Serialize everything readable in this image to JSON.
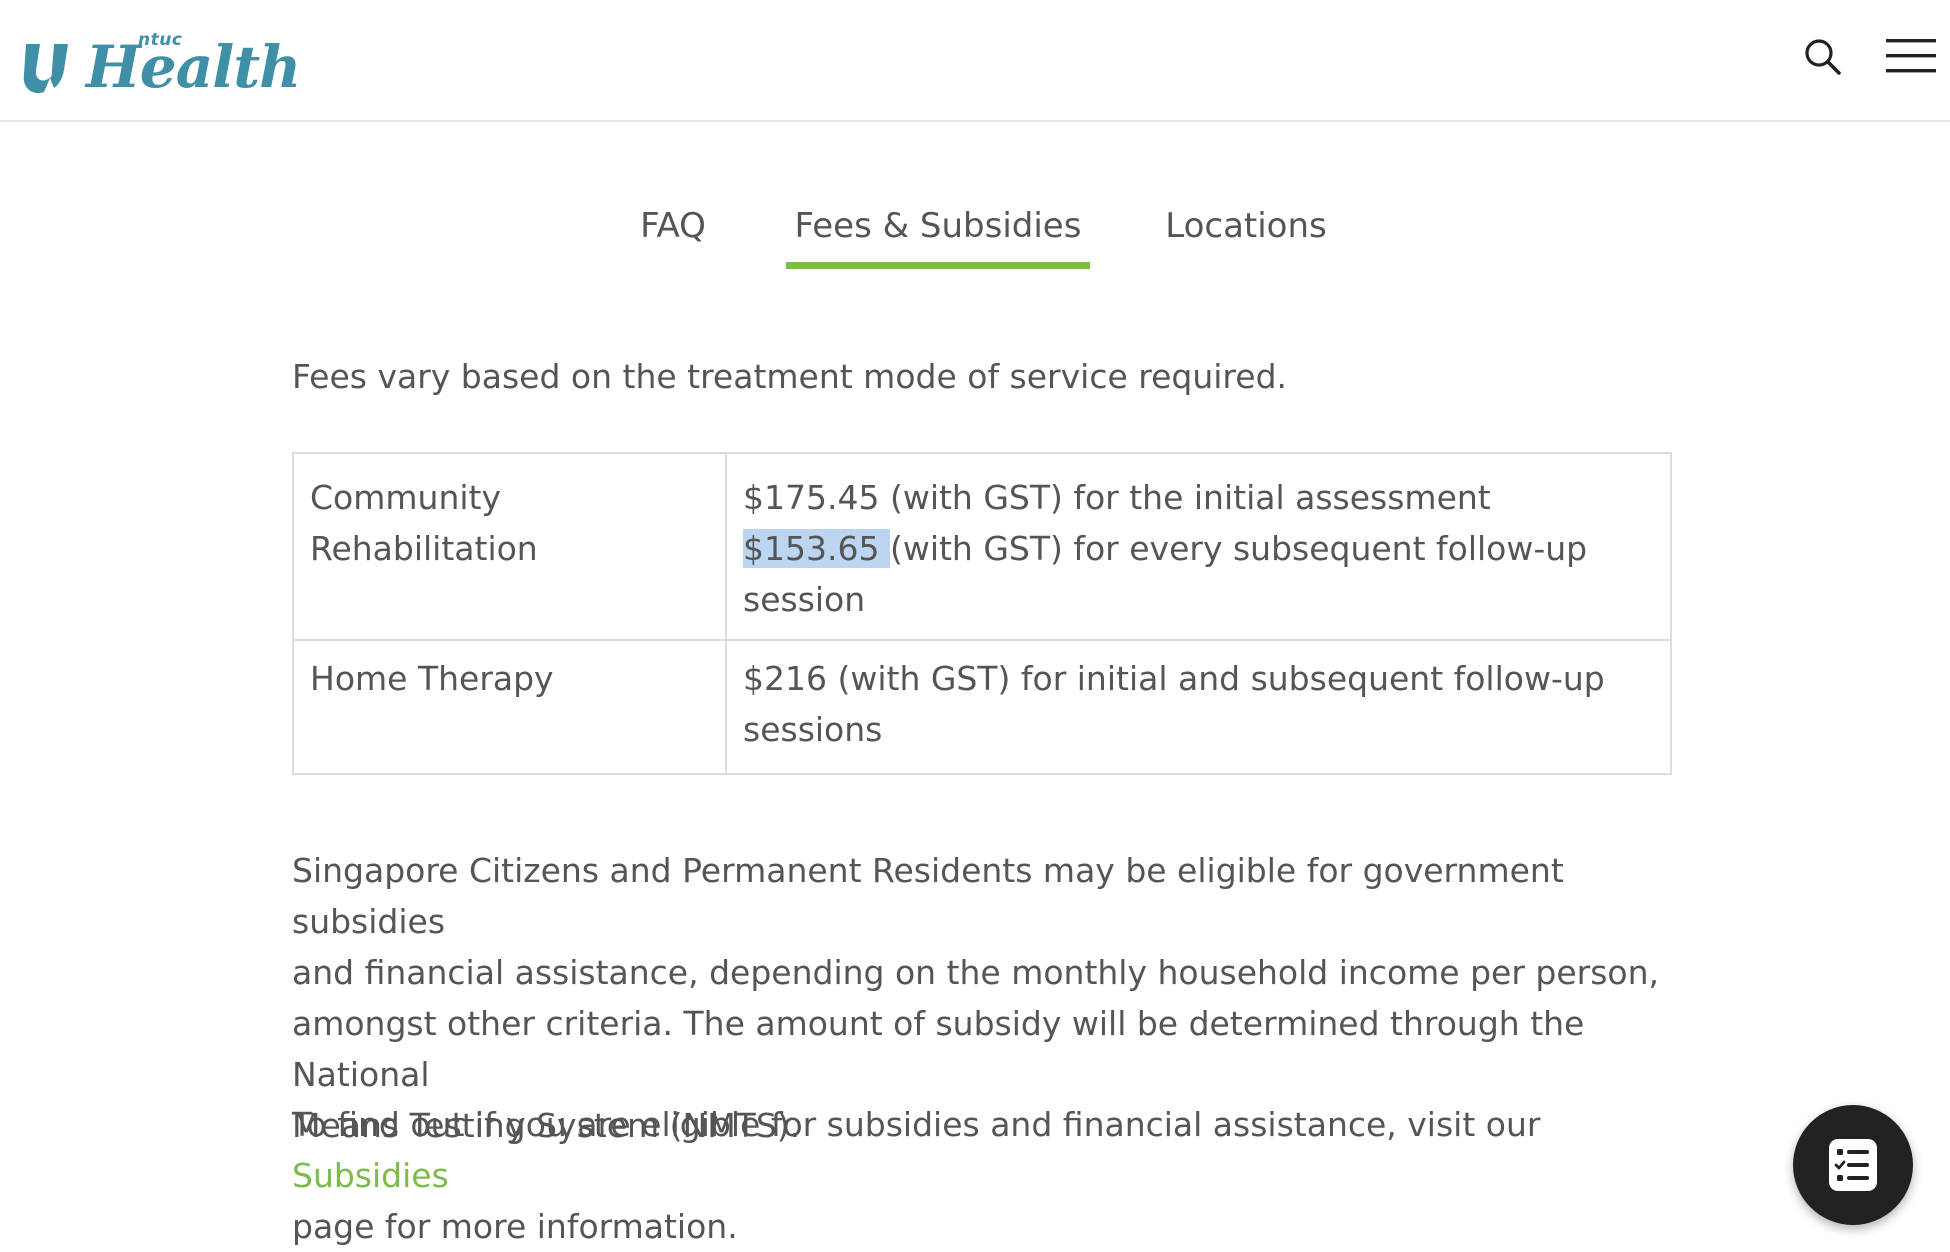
{
  "brand": {
    "ntuc": "ntuc",
    "name": "Health",
    "color": "#3f8fa6"
  },
  "header": {
    "search_icon": "search-icon",
    "menu_icon": "hamburger-menu-icon"
  },
  "tabs": [
    {
      "label": "FAQ",
      "active": false
    },
    {
      "label": "Fees & Subsidies",
      "active": true
    },
    {
      "label": "Locations",
      "active": false
    }
  ],
  "accent_color": "#7dbb4a",
  "content": {
    "intro": "Fees vary based on the treatment mode of service required.",
    "fees_table": {
      "rows": [
        {
          "service_line1": "Community",
          "service_line2": "Rehabilitation",
          "fee_line1": "$175.45 (with GST) for the initial assessment",
          "fee_highlight": "$153.65 ",
          "fee_line2_rest": "(with GST) for every subsequent follow-up",
          "fee_line3": "session"
        },
        {
          "service": "Home Therapy",
          "fee_line1": "$216 (with GST) for initial and subsequent follow-up",
          "fee_line2": "sessions"
        }
      ]
    },
    "subsidy_para": {
      "line1": "Singapore Citizens and Permanent Residents may be eligible for government subsidies",
      "line2": "and financial assistance, depending on the monthly household income per person,",
      "line3": "amongst other criteria. The amount of subsidy will be determined through the National",
      "line4": "Means Testing System (NMTS)."
    },
    "eligibility_para": {
      "text_before": "To find out if you are eligible for subsidies and financial assistance, visit our ",
      "link": "Subsidies",
      "text_after": "page for more information."
    }
  },
  "fab": {
    "icon": "checklist-icon"
  }
}
